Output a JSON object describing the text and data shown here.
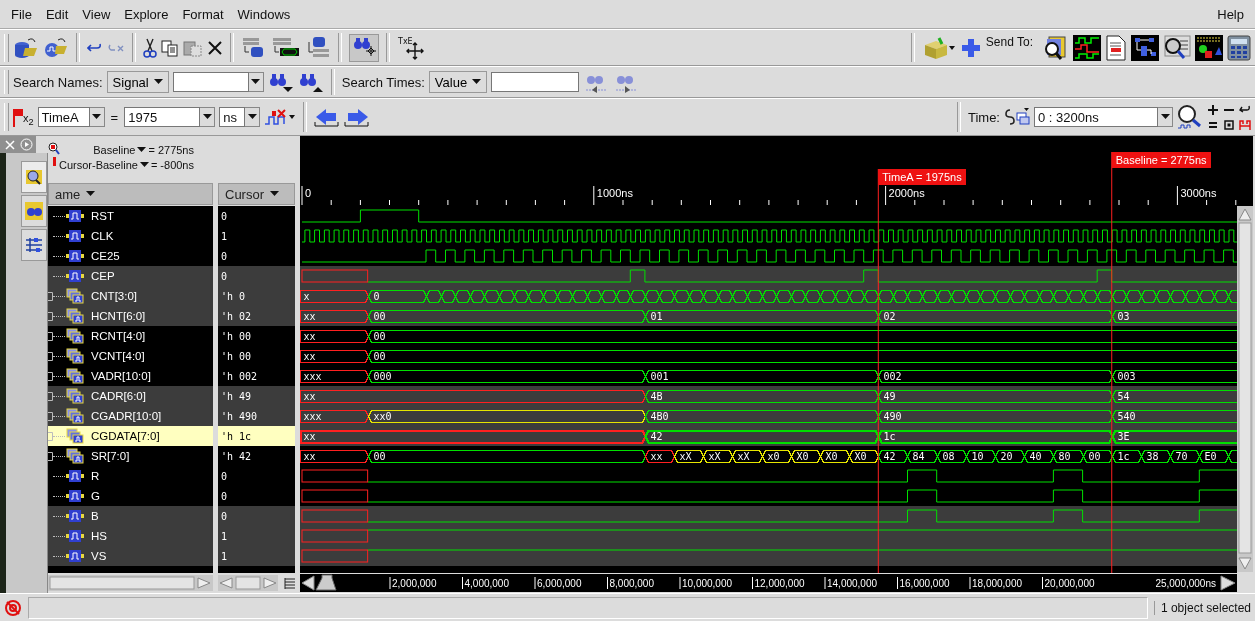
{
  "menu": [
    {
      "label": "File"
    },
    {
      "label": "Edit"
    },
    {
      "label": "View"
    },
    {
      "label": "Explore"
    },
    {
      "label": "Format"
    },
    {
      "label": "Windows"
    }
  ],
  "help_menu": {
    "label": "Help"
  },
  "toolbar": {
    "move_icon_text": "TxE",
    "send_to_label": "Send To:"
  },
  "search_bar": {
    "names_label": "Search Names:",
    "names_type": "Signal",
    "times_label": "Search Times:",
    "times_type": "Value"
  },
  "marker_bar": {
    "flag_text": "x$_{2}$",
    "marker": "TimeA",
    "equals": "=",
    "time": "1975",
    "unit": "ns",
    "time_label": "Time:",
    "time_range": "0 : 3200ns"
  },
  "baseline": {
    "baseline_label": "Baseline",
    "baseline_value": "= 2775ns",
    "delta_label": "Cursor-Baseline",
    "delta_value": "= -800ns"
  },
  "columns": [
    {
      "label": "ame"
    },
    {
      "label": "Cursor"
    }
  ],
  "signals": [
    {
      "name": "RST",
      "kind": "bit",
      "cursor": "0",
      "selected": false
    },
    {
      "name": "CLK",
      "kind": "bit",
      "cursor": "1",
      "selected": false
    },
    {
      "name": "CE25",
      "kind": "bit",
      "cursor": "0",
      "selected": false
    },
    {
      "name": "CEP",
      "kind": "bit",
      "cursor": "0",
      "selected": false
    },
    {
      "name": "CNT[3:0]",
      "kind": "bus",
      "cursor": "'h 0",
      "selected": false,
      "segments": [
        {
          "value": "x",
          "color": "#ff2020"
        },
        {
          "value": "0",
          "color": "#00e000"
        },
        {
          "color": "#00e000"
        },
        {
          "color": "#00e000"
        },
        {
          "color": "#00e000"
        },
        {
          "color": "#00e000"
        },
        {
          "color": "#00e000"
        },
        {
          "color": "#00e000"
        },
        {
          "color": "#00e000"
        },
        {
          "color": "#00e000"
        },
        {
          "color": "#00e000"
        },
        {
          "color": "#00e000"
        },
        {
          "color": "#00e000"
        },
        {
          "color": "#00e000"
        },
        {
          "color": "#00e000"
        },
        {
          "color": "#00e000"
        },
        {
          "color": "#00e000"
        },
        {
          "color": "#00e000"
        },
        {
          "color": "#00e000"
        },
        {
          "color": "#00e000"
        },
        {
          "color": "#00e000"
        },
        {
          "color": "#00e000"
        },
        {
          "color": "#00e000"
        },
        {
          "color": "#00e000"
        },
        {
          "color": "#00e000"
        },
        {
          "color": "#00e000"
        },
        {
          "color": "#00e000"
        },
        {
          "color": "#00e000"
        },
        {
          "color": "#00e000"
        },
        {
          "color": "#00e000"
        },
        {
          "color": "#00e000"
        },
        {
          "color": "#00e000"
        },
        {
          "color": "#00e000"
        },
        {
          "color": "#00e000"
        },
        {
          "color": "#00e000"
        },
        {
          "color": "#00e000"
        },
        {
          "color": "#00e000"
        },
        {
          "color": "#00e000"
        },
        {
          "color": "#00e000"
        },
        {
          "color": "#00e000"
        },
        {
          "color": "#00e000"
        },
        {
          "color": "#00e000"
        },
        {
          "color": "#00e000"
        },
        {
          "color": "#00e000"
        },
        {
          "color": "#00e000"
        },
        {
          "color": "#00e000"
        },
        {
          "color": "#00e000"
        },
        {
          "color": "#00e000"
        },
        {
          "color": "#00e000"
        },
        {
          "color": "#00e000"
        },
        {
          "color": "#00e000"
        },
        {
          "color": "#00e000"
        },
        {
          "color": "#00e000"
        },
        {
          "color": "#00e000"
        },
        {
          "color": "#00e000"
        },
        {
          "color": "#00e000"
        },
        {
          "color": "#00e000"
        },
        {
          "color": "#00e000"
        }
      ]
    },
    {
      "name": "HCNT[6:0]",
      "kind": "bus",
      "cursor": "'h 02",
      "selected": false,
      "segments": [
        {
          "value": "xx",
          "color": "#ff2020"
        },
        {
          "value": "00",
          "color": "#00e000"
        },
        {
          "value": "01",
          "color": "#00e000"
        },
        {
          "value": "02",
          "color": "#00e000"
        },
        {
          "value": "03",
          "color": "#00e000"
        }
      ]
    },
    {
      "name": "RCNT[4:0]",
      "kind": "bus",
      "cursor": "'h 00",
      "selected": false,
      "segments": [
        {
          "value": "xx",
          "color": "#ff2020"
        },
        {
          "value": "00",
          "color": "#00e000"
        }
      ]
    },
    {
      "name": "VCNT[4:0]",
      "kind": "bus",
      "cursor": "'h 00",
      "selected": false,
      "segments": [
        {
          "value": "xx",
          "color": "#ff2020"
        },
        {
          "value": "00",
          "color": "#00e000"
        }
      ]
    },
    {
      "name": "VADR[10:0]",
      "kind": "bus",
      "cursor": "'h 002",
      "selected": false,
      "segments": [
        {
          "value": "xxx",
          "color": "#ff2020"
        },
        {
          "value": "000",
          "color": "#00e000"
        },
        {
          "value": "001",
          "color": "#00e000"
        },
        {
          "value": "002",
          "color": "#00e000"
        },
        {
          "value": "003",
          "color": "#00e000"
        }
      ]
    },
    {
      "name": "CADR[6:0]",
      "kind": "bus",
      "cursor": "'h 49",
      "selected": false,
      "segments": [
        {
          "value": "xx",
          "color": "#ff2020"
        },
        {
          "value": "4B",
          "color": "#00e000"
        },
        {
          "value": "49",
          "color": "#00e000"
        },
        {
          "value": "54",
          "color": "#00e000"
        }
      ]
    },
    {
      "name": "CGADR[10:0]",
      "kind": "bus",
      "cursor": "'h 490",
      "selected": false,
      "segments": [
        {
          "value": "xxx",
          "color": "#ff2020"
        },
        {
          "value": "xx0",
          "color": "#e6e600"
        },
        {
          "value": "4B0",
          "color": "#00e000"
        },
        {
          "value": "490",
          "color": "#00e000"
        },
        {
          "value": "540",
          "color": "#00e000"
        }
      ]
    },
    {
      "name": "CGDATA[7:0]",
      "kind": "bus",
      "cursor": "'h 1c",
      "selected": true,
      "segments": [
        {
          "value": "xx",
          "color": "#ff2020"
        },
        {
          "value": "42",
          "color": "#00e000"
        },
        {
          "value": "1c",
          "color": "#00e000"
        },
        {
          "value": "3E",
          "color": "#00e000"
        }
      ]
    },
    {
      "name": "SR[7:0]",
      "kind": "bus",
      "cursor": "'h 42",
      "selected": false,
      "segments": [
        {
          "value": "xx",
          "color": "#ff2020"
        },
        {
          "value": "00",
          "color": "#00e000"
        },
        {
          "value": "xx",
          "color": "#ff2020"
        },
        {
          "value": "xX",
          "color": "#e6e600"
        },
        {
          "value": "xX",
          "color": "#e6e600"
        },
        {
          "value": "xX",
          "color": "#e6e600"
        },
        {
          "value": "x0",
          "color": "#e6e600"
        },
        {
          "value": "X0",
          "color": "#e6e600"
        },
        {
          "value": "X0",
          "color": "#e6e600"
        },
        {
          "value": "X0",
          "color": "#e6e600"
        },
        {
          "value": "42",
          "color": "#00e000"
        },
        {
          "value": "84",
          "color": "#00e000"
        },
        {
          "value": "08",
          "color": "#00e000"
        },
        {
          "value": "10",
          "color": "#00e000"
        },
        {
          "value": "20",
          "color": "#00e000"
        },
        {
          "value": "40",
          "color": "#00e000"
        },
        {
          "value": "80",
          "color": "#00e000"
        },
        {
          "value": "00",
          "color": "#00e000"
        },
        {
          "value": "1c",
          "color": "#00e000"
        },
        {
          "value": "38",
          "color": "#00e000"
        },
        {
          "value": "70",
          "color": "#00e000"
        },
        {
          "value": "E0",
          "color": "#00e000"
        },
        {
          "color": "#00e000"
        }
      ]
    },
    {
      "name": "R",
      "kind": "bit",
      "cursor": "0",
      "selected": false
    },
    {
      "name": "G",
      "kind": "bit",
      "cursor": "0",
      "selected": false
    },
    {
      "name": "B",
      "kind": "bit",
      "cursor": "0",
      "selected": false
    },
    {
      "name": "HS",
      "kind": "bit",
      "cursor": "1",
      "selected": false
    },
    {
      "name": "VS",
      "kind": "bit",
      "cursor": "1",
      "selected": false
    }
  ],
  "timeline": {
    "ticks": [
      "0",
      "1000ns",
      "2000ns",
      "3000ns"
    ],
    "markers": [
      {
        "label": "TimeA = 1975ns"
      },
      {
        "label": "Baseline = 2775ns"
      }
    ]
  },
  "overview_ticks": [
    "2,000,000",
    "4,000,000",
    "6,000,000",
    "8,000,000",
    "10,000,000",
    "12,000,000",
    "14,000,000",
    "16,000,000",
    "18,000,000",
    "20,000,000",
    "25,000,000ns"
  ],
  "status_bar": {
    "message": "1 object selected"
  }
}
